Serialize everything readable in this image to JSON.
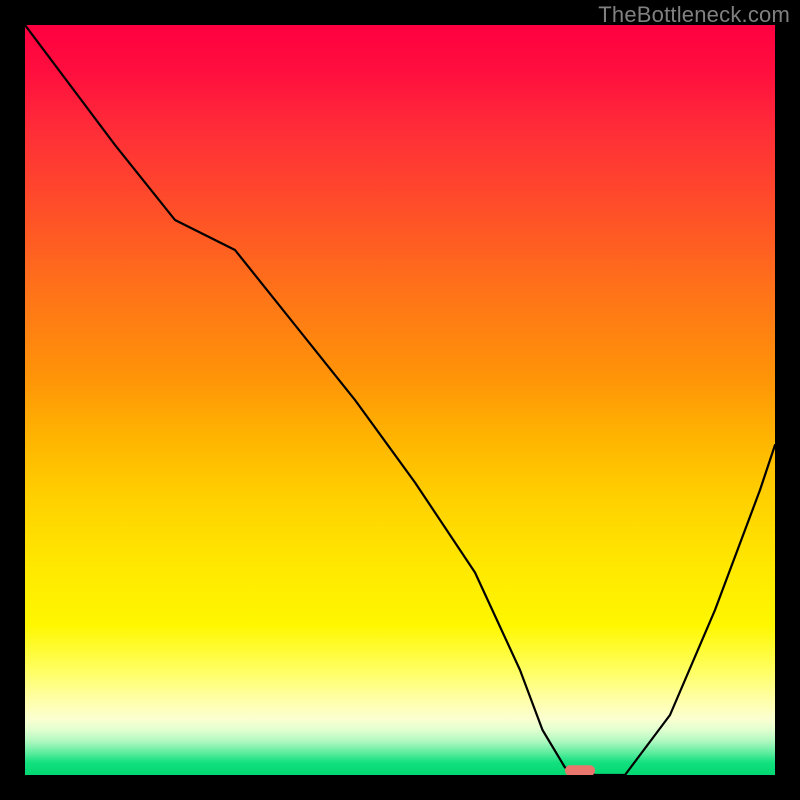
{
  "watermark": "TheBottleneck.com",
  "chart_data": {
    "type": "line",
    "title": "",
    "xlabel": "",
    "ylabel": "",
    "xlim": [
      0,
      100
    ],
    "ylim": [
      0,
      100
    ],
    "background": {
      "type": "vertical-gradient",
      "stops": [
        {
          "pos": 0,
          "color": "#ff0040"
        },
        {
          "pos": 0.25,
          "color": "#ff5028"
        },
        {
          "pos": 0.55,
          "color": "#ffb400"
        },
        {
          "pos": 0.8,
          "color": "#fff700"
        },
        {
          "pos": 0.94,
          "color": "#e0ffd0"
        },
        {
          "pos": 1.0,
          "color": "#00d870"
        }
      ]
    },
    "series": [
      {
        "name": "bottleneck-curve",
        "x": [
          0,
          6,
          12,
          20,
          28,
          36,
          44,
          52,
          60,
          66,
          69,
          72,
          76,
          80,
          86,
          92,
          98,
          100
        ],
        "y": [
          100,
          92,
          84,
          74,
          70,
          60,
          50,
          39,
          27,
          14,
          6,
          1,
          0,
          0,
          8,
          22,
          38,
          44
        ]
      }
    ],
    "marker": {
      "name": "optimal-point",
      "x": 74,
      "y": 0.6,
      "width": 4,
      "height": 1.4,
      "color": "#e8766c",
      "shape": "rounded-rect"
    }
  }
}
